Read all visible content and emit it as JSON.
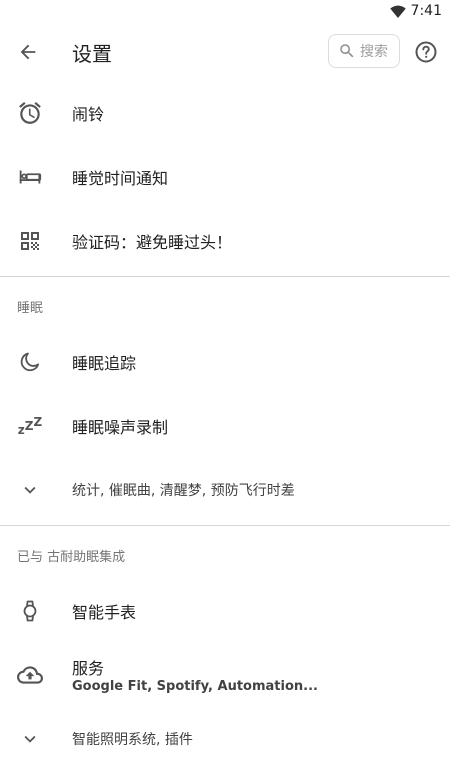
{
  "status_bar": {
    "time": "7:41",
    "wifi_icon": "wifi-icon"
  },
  "app_bar": {
    "back_icon": "arrow-back-icon",
    "title": "设置",
    "search": {
      "icon": "search-icon",
      "placeholder": "搜索"
    },
    "help_icon": "help-icon"
  },
  "items_top": [
    {
      "icon": "alarm-icon",
      "label": "闹铃"
    },
    {
      "icon": "bed-icon",
      "label": "睡觉时间通知"
    },
    {
      "icon": "qr-code-icon",
      "label": "验证码：避免睡过头！"
    }
  ],
  "sleep_section": {
    "header": "睡眠",
    "items": [
      {
        "icon": "moon-icon",
        "label": "睡眠追踪"
      },
      {
        "icon": "zzz-icon",
        "label": "睡眠噪声录制",
        "zzz": "zZZ"
      },
      {
        "icon": "chevron-down-icon",
        "label": "统计, 催眠曲, 清醒梦, 预防飞行时差"
      }
    ]
  },
  "integration_section": {
    "header": "已与 古耐助眠集成",
    "items": [
      {
        "icon": "watch-icon",
        "label": "智能手表"
      },
      {
        "icon": "cloud-upload-icon",
        "label": "服务",
        "subtitle": "Google Fit, Spotify, Automation..."
      },
      {
        "icon": "chevron-down-icon",
        "label": "智能照明系统, 插件"
      }
    ]
  },
  "colors": {
    "text_primary": "#212121",
    "text_secondary": "#757575",
    "icon": "#555555",
    "divider": "#d6d6d6"
  }
}
